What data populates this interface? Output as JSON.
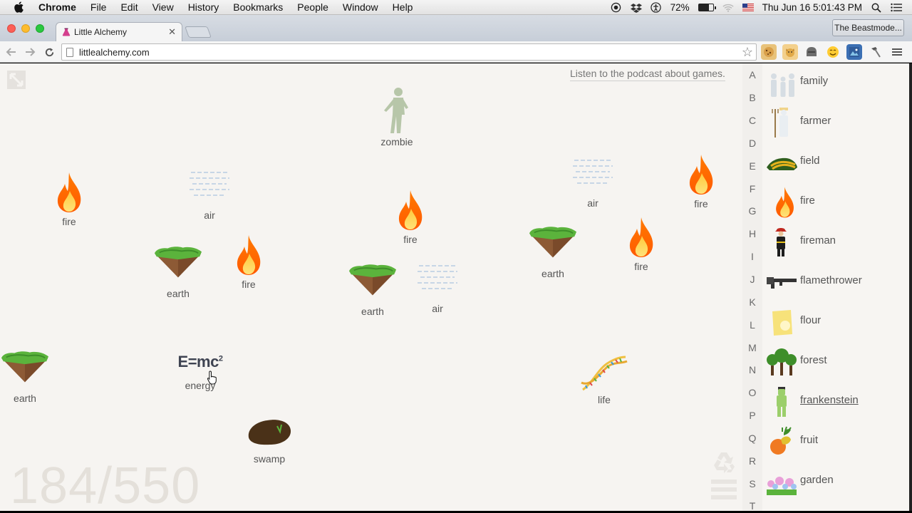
{
  "menubar": {
    "app": "Chrome",
    "items": [
      "File",
      "Edit",
      "View",
      "History",
      "Bookmarks",
      "People",
      "Window",
      "Help"
    ],
    "battery": "72%",
    "battery_level": 0.72,
    "datetime": "Thu Jun 16  5:01:43 PM"
  },
  "browser": {
    "tab_title": "Little Alchemy",
    "profile_name": "The Beastmode...",
    "url": "littlealchemy.com"
  },
  "game": {
    "podcast_link": "Listen to the podcast about games.",
    "counter": "184/550",
    "elements": {
      "zombie": "zombie",
      "fire1": "fire",
      "air1": "air",
      "fire2": "fire",
      "air2": "air",
      "fire3": "fire",
      "earth1": "earth",
      "fire4": "fire",
      "earth2": "earth",
      "fire5": "fire",
      "earth3": "earth",
      "air3": "air",
      "earth4": "earth",
      "energy": "energy",
      "energy_formula": "E=mc",
      "energy_power": "2",
      "life": "life",
      "swamp": "swamp"
    }
  },
  "alphabet": [
    "A",
    "B",
    "C",
    "D",
    "E",
    "F",
    "G",
    "H",
    "I",
    "J",
    "K",
    "L",
    "M",
    "N",
    "O",
    "P",
    "Q",
    "R",
    "S",
    "T"
  ],
  "library": [
    {
      "name": "family",
      "icon": "family-icon"
    },
    {
      "name": "farmer",
      "icon": "farmer-icon"
    },
    {
      "name": "field",
      "icon": "field-icon"
    },
    {
      "name": "fire",
      "icon": "fire-icon"
    },
    {
      "name": "fireman",
      "icon": "fireman-icon"
    },
    {
      "name": "flamethrower",
      "icon": "flamethrower-icon"
    },
    {
      "name": "flour",
      "icon": "flour-icon"
    },
    {
      "name": "forest",
      "icon": "forest-icon"
    },
    {
      "name": "frankenstein",
      "icon": "frankenstein-icon"
    },
    {
      "name": "fruit",
      "icon": "fruit-icon"
    },
    {
      "name": "garden",
      "icon": "garden-icon"
    }
  ]
}
